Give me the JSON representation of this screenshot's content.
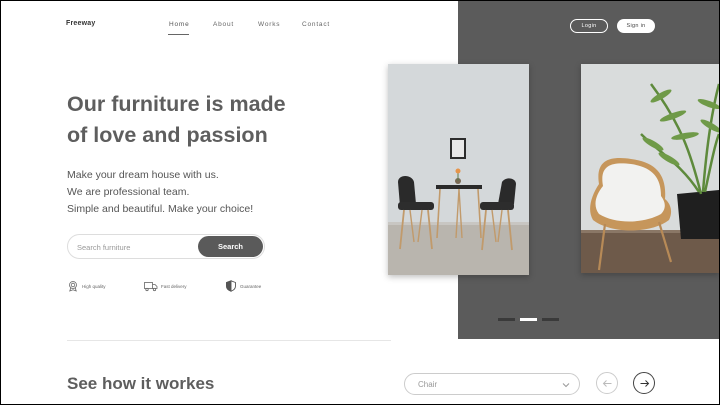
{
  "brand": {
    "logo": "Freeway"
  },
  "nav": {
    "items": [
      {
        "label": "Home",
        "active": true
      },
      {
        "label": "About",
        "active": false
      },
      {
        "label": "Works",
        "active": false
      },
      {
        "label": "Contact",
        "active": false
      }
    ]
  },
  "auth": {
    "login_label": "Login",
    "signin_label": "Sign in"
  },
  "hero": {
    "headline_line1": "Our furniture is made",
    "headline_line2": "of love and passion",
    "sub_lines": [
      "Make your dream house with us.",
      "We are professional team.",
      "Simple and beautiful. Make your choice!"
    ]
  },
  "search": {
    "placeholder": "Search furniture",
    "button_label": "Search"
  },
  "features": [
    {
      "icon": "badge-icon",
      "label": "High quality"
    },
    {
      "icon": "truck-icon",
      "label": "Fast delivery"
    },
    {
      "icon": "shield-icon",
      "label": "Guarantee"
    }
  ],
  "carousel": {
    "slide_count": 3,
    "active_index": 1
  },
  "how_it_works": {
    "title": "See how it workes",
    "select_value": "Chair"
  },
  "colors": {
    "dark_panel": "#5b5b5b",
    "text": "#5e5e5e",
    "button": "#5a5a5a",
    "background": "#ffffff"
  }
}
